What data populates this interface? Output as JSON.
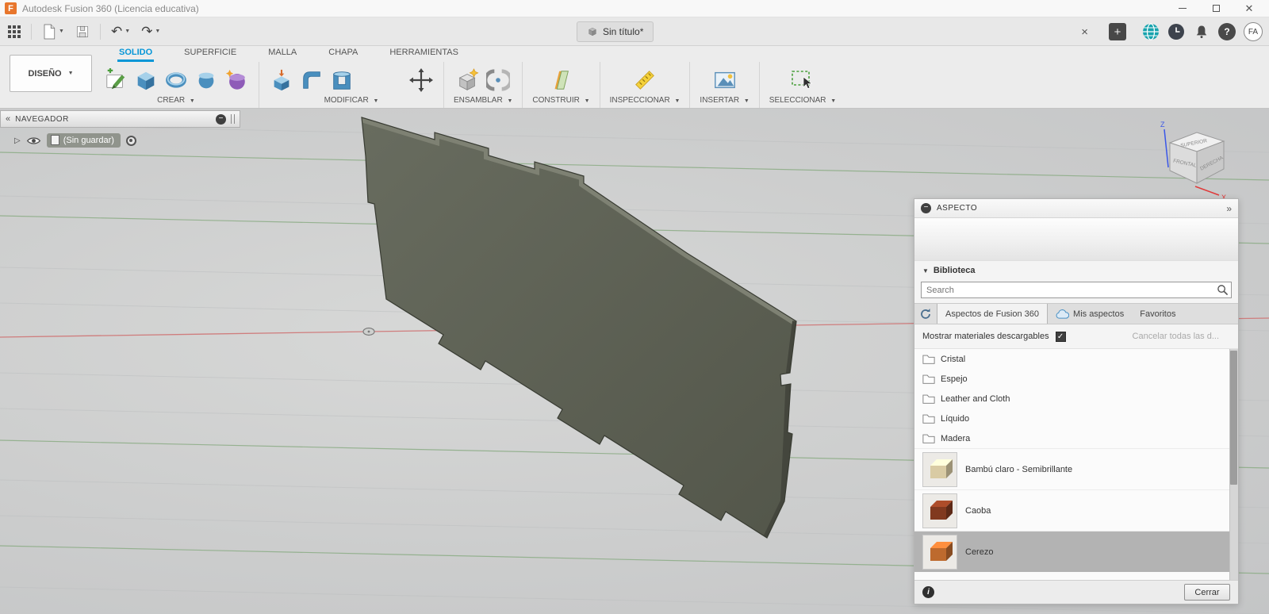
{
  "titlebar": {
    "logo": "F",
    "title": "Autodesk Fusion 360 (Licencia educativa)"
  },
  "qat": {
    "document_tab": "Sin título*",
    "user_initials": "FA"
  },
  "ribbon": {
    "workspace": "DISEÑO",
    "tabs": [
      "SOLIDO",
      "SUPERFICIE",
      "MALLA",
      "CHAPA",
      "HERRAMIENTAS"
    ],
    "groups": [
      {
        "label": "CREAR"
      },
      {
        "label": "MODIFICAR"
      },
      {
        "label": "ENSAMBLAR"
      },
      {
        "label": "CONSTRUIR"
      },
      {
        "label": "INSPECCIONAR"
      },
      {
        "label": "INSERTAR"
      },
      {
        "label": "SELECCIONAR"
      }
    ]
  },
  "navigator": {
    "title": "NAVEGADOR",
    "root_item": "(Sin guardar)"
  },
  "viewcube": {
    "z": "Z",
    "x": "X",
    "top": "SUPERIOR",
    "front": "FRONTAL",
    "right": "DERECHA"
  },
  "aspect": {
    "title": "ASPECTO",
    "library": "Biblioteca",
    "search_placeholder": "Search",
    "tabs": [
      "Aspectos de Fusion 360",
      "Mis aspectos",
      "Favoritos"
    ],
    "show_downloadable": "Mostrar materiales descargables",
    "cancel_all": "Cancelar todas las d...",
    "folders": [
      "Cristal",
      "Espejo",
      "Leather and Cloth",
      "Líquido",
      "Madera"
    ],
    "materials": [
      {
        "name": "Bambú claro - Semibrillante",
        "color": "#d9cba4"
      },
      {
        "name": "Caoba",
        "color": "#81391f"
      },
      {
        "name": "Cerezo",
        "color": "#bd6a2e"
      }
    ],
    "close": "Cerrar"
  },
  "colors": {
    "accent": "#0696d7",
    "model_face": "#5d6055"
  }
}
